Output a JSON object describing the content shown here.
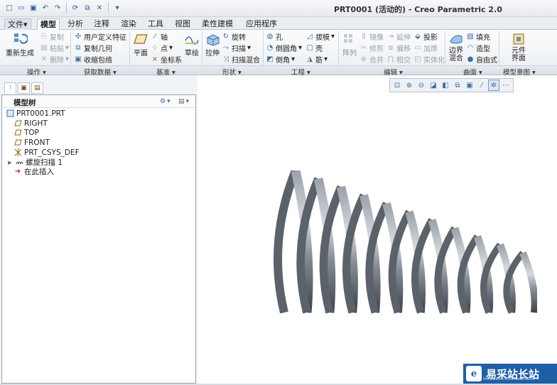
{
  "window": {
    "title": "PRT0001 (活动的) - Creo Parametric 2.0"
  },
  "quick_access": [
    "new-icon",
    "open-icon",
    "save-icon",
    "undo-icon",
    "redo-icon",
    "regenerate-icon",
    "windows-icon",
    "close-icon",
    "customize-icon"
  ],
  "tabs": [
    {
      "label": "文件",
      "dropdown": "▾"
    },
    {
      "label": "模型"
    },
    {
      "label": "分析"
    },
    {
      "label": "注释"
    },
    {
      "label": "渲染"
    },
    {
      "label": "工具"
    },
    {
      "label": "视图"
    },
    {
      "label": "柔性建模"
    },
    {
      "label": "应用程序"
    }
  ],
  "ribbon": {
    "operations": {
      "group": "操作",
      "regenerate": "重新生成",
      "copy": "复制",
      "paste": "粘贴",
      "delete": "删除"
    },
    "get_data": {
      "group": "获取数据",
      "udf": "用户定义特征",
      "copy_geom": "复制几何",
      "shrinkwrap": "收缩包络"
    },
    "datum": {
      "group": "基准",
      "plane": "平面",
      "axis": "轴",
      "point": "点",
      "csys": "坐标系",
      "sketch": "草绘"
    },
    "shapes": {
      "group": "形状",
      "extrude": "拉伸",
      "revolve": "旋转",
      "sweep": "扫描",
      "swept_blend": "扫描混合"
    },
    "engineering": {
      "group": "工程",
      "hole": "孔",
      "round": "倒圆角",
      "chamfer": "倒角",
      "draft": "拔模",
      "shell": "壳",
      "rib": "筋"
    },
    "editing": {
      "group": "编辑",
      "pattern": "阵列",
      "mirror": "镜像",
      "trim": "修剪",
      "merge": "合并",
      "extend": "延伸",
      "offset": "偏移",
      "intersect": "相交",
      "project": "投影",
      "thicken": "加厚",
      "solidify": "实体化"
    },
    "surfaces": {
      "group": "曲面",
      "boundary_blend": [
        "边界",
        "混合"
      ],
      "fill": "填充",
      "style": "造型",
      "freestyle": "自由式"
    },
    "model_intent": {
      "group": "模型意图",
      "component_interface": [
        "元件",
        "界面"
      ]
    }
  },
  "model_tree": {
    "title": "模型树",
    "items": [
      {
        "label": "PRT0001.PRT",
        "icon": "part-icon"
      },
      {
        "label": "RIGHT",
        "icon": "datum-plane-icon"
      },
      {
        "label": "TOP",
        "icon": "datum-plane-icon"
      },
      {
        "label": "FRONT",
        "icon": "datum-plane-icon"
      },
      {
        "label": "PRT_CSYS_DEF",
        "icon": "csys-icon"
      },
      {
        "label": "螺旋扫描 1",
        "icon": "helical-sweep-icon"
      },
      {
        "label": "在此插入",
        "icon": "insert-here-icon"
      }
    ]
  },
  "view_toolbar": [
    "refit-icon",
    "zoom-in-icon",
    "zoom-out-icon",
    "repaint-icon",
    "display-style-icon",
    "saved-orientations-icon",
    "view-manager-icon",
    "datum-display-icon",
    "spin-center-icon",
    "annotation-display-icon"
  ],
  "colors": {
    "spring_light": "#c9ced4",
    "spring_dark": "#4a5058",
    "accent": "#1f5fa8"
  },
  "watermark": {
    "text": "易采站长站",
    "sub": "Www.Easck.Com  Webmaster"
  }
}
